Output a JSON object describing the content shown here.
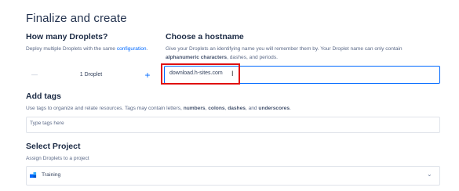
{
  "page_title": "Finalize and create",
  "droplets": {
    "heading": "How many Droplets?",
    "description_prefix": "Deploy multiple Droplets with the same",
    "description_link": "configuration",
    "description_suffix": ".",
    "minus_label": "—",
    "count_label": "1  Droplet",
    "plus_label": "+"
  },
  "hostname": {
    "heading": "Choose a hostname",
    "desc_1": "Give your Droplets an identifying name you will remember them by. Your Droplet name can only contain",
    "desc_2a": "alphanumeric characters",
    "desc_2b": ", dashes, and periods.",
    "value": "download.h-sites.com"
  },
  "tags": {
    "heading": "Add tags",
    "desc_a": "Use tags to organize and relate resources. Tags may contain letters, ",
    "desc_numbers": "numbers",
    "desc_b": ", ",
    "desc_colons": "colons",
    "desc_c": ", ",
    "desc_dashes": "dashes",
    "desc_d": ", and ",
    "desc_underscores": "underscores",
    "desc_e": ".",
    "placeholder": "Type tags here"
  },
  "project": {
    "heading": "Select Project",
    "description": "Assign Droplets to a project",
    "selected": "Training"
  },
  "colors": {
    "accent": "#0069ff",
    "highlight": "#e01111"
  }
}
